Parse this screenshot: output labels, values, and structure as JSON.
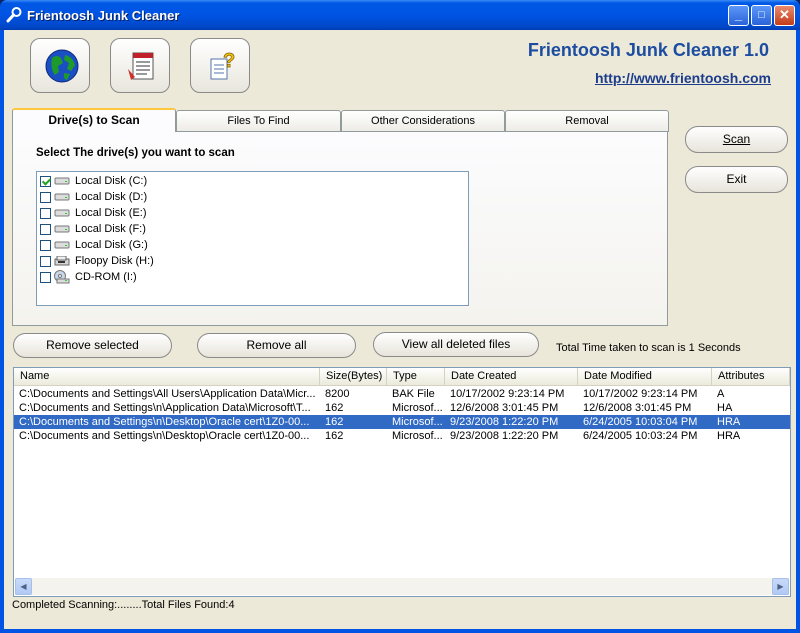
{
  "window": {
    "title": "Frientoosh Junk Cleaner",
    "min_label": "_",
    "max_label": "□",
    "close_label": "✕"
  },
  "toolbar": {
    "icons": [
      "globe-icon",
      "notepad-icon",
      "help-icon"
    ]
  },
  "header": {
    "app_title": "Frientoosh Junk Cleaner 1.0",
    "url": "http://www.frientoosh.com"
  },
  "tabs": [
    {
      "label": "Drive(s) to Scan",
      "active": true
    },
    {
      "label": "Files To Find",
      "active": false
    },
    {
      "label": "Other Considerations",
      "active": false
    },
    {
      "label": "Removal",
      "active": false
    }
  ],
  "drive_panel": {
    "label": "Select The drive(s) you want to scan",
    "drives": [
      {
        "label": "Local Disk (C:)",
        "checked": true
      },
      {
        "label": "Local Disk (D:)",
        "checked": false
      },
      {
        "label": "Local Disk (E:)",
        "checked": false
      },
      {
        "label": "Local Disk (F:)",
        "checked": false
      },
      {
        "label": "Local Disk (G:)",
        "checked": false
      },
      {
        "label": "Floopy Disk (H:)",
        "checked": false
      },
      {
        "label": "CD-ROM (I:)",
        "checked": false
      }
    ]
  },
  "side_buttons": {
    "scan": "Scan",
    "exit": "Exit"
  },
  "action_buttons": {
    "remove_selected": "Remove selected",
    "remove_all": "Remove all",
    "view_deleted": "View all deleted files"
  },
  "total_time": "Total Time taken to scan is 1 Seconds",
  "results": {
    "columns": [
      "Name",
      "Size(Bytes)",
      "Type",
      "Date Created",
      "Date Modified",
      "Attributes"
    ],
    "rows": [
      [
        "C:\\Documents and Settings\\All Users\\Application Data\\Micr...",
        "8200",
        "BAK File",
        "10/17/2002 9:23:14 PM",
        "10/17/2002 9:23:14 PM",
        "A"
      ],
      [
        "C:\\Documents and Settings\\n\\Application Data\\Microsoft\\T...",
        "162",
        "Microsof...",
        "12/6/2008 3:01:45 PM",
        "12/6/2008 3:01:45 PM",
        "HA"
      ],
      [
        "C:\\Documents and Settings\\n\\Desktop\\Oracle cert\\1Z0-00...",
        "162",
        "Microsof...",
        "9/23/2008 1:22:20 PM",
        "6/24/2005 10:03:04 PM",
        "HRA"
      ],
      [
        "C:\\Documents and Settings\\n\\Desktop\\Oracle cert\\1Z0-00...",
        "162",
        "Microsof...",
        "9/23/2008 1:22:20 PM",
        "6/24/2005 10:03:24 PM",
        "HRA"
      ]
    ],
    "selected_row": 2
  },
  "status": "Completed Scanning:........Total Files Found:4",
  "colors": {
    "selection": "#316ac5",
    "title_bar": "#0054e3",
    "face": "#ece9d8"
  }
}
